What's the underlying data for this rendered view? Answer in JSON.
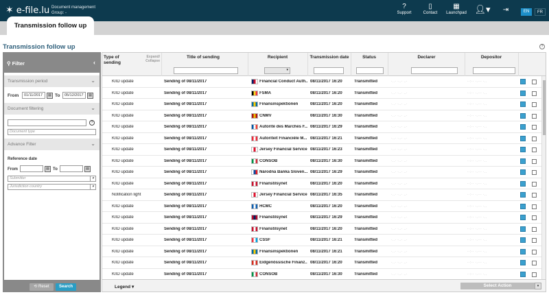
{
  "brand": {
    "name": "e-file.lu",
    "subtitle_line1": "Document management",
    "subtitle_line2": "Group: -"
  },
  "topnav": [
    {
      "label": "Support",
      "icon": "question-circle-icon"
    },
    {
      "label": "Contact",
      "icon": "phone-icon"
    },
    {
      "label": "Launchpad",
      "icon": "grid-icon"
    }
  ],
  "languages": {
    "en": "EN",
    "fr": "FR"
  },
  "tab": {
    "label": "Transmission follow up"
  },
  "page": {
    "title": "Transmission follow up",
    "help": "?"
  },
  "filter": {
    "title": "Filter",
    "sections": {
      "period": "Transmission period",
      "doc": "Document filtering",
      "advance": "Advance Filter"
    },
    "from_label": "From",
    "to_label": "To",
    "from_value": "01/11/2017",
    "to_value": "05/12/2017",
    "doc_type_placeholder": "Document type",
    "reference_date_label": "Reference date",
    "ref_from_label": "From",
    "ref_to_label": "To",
    "submitter_placeholder": "Submitter",
    "jurisdiction_placeholder": "Jurisdiction country",
    "reset_label": "Reset",
    "search_label": "Search"
  },
  "table": {
    "headers": {
      "type": "Type of sending",
      "expand": "Expand/ Collapse",
      "title": "Title of sending",
      "recipient": "Recipient",
      "date": "Transmission date",
      "status": "Status",
      "declarer": "Declarer",
      "depositor": "Depositor"
    },
    "rows": [
      {
        "type": "KIID update",
        "title": "Sending of 08/11/2017",
        "flag": "gb",
        "recipient": "Financial Conduct Auth...",
        "date": "08/11/2017 16:20",
        "status": "Transmitted",
        "declarer": "·..· ·..· ..·",
        "depositor": "··:·· ·.··· ·.."
      },
      {
        "type": "KIID update",
        "title": "Sending of 08/11/2017",
        "flag": "be",
        "recipient": "FSMA",
        "date": "08/11/2017 16:20",
        "status": "Transmitted",
        "declarer": "·..· ·..· ..·",
        "depositor": "··:·· ·.··· ·.."
      },
      {
        "type": "KIID update",
        "title": "Sending of 08/11/2017",
        "flag": "se",
        "recipient": "Finansinspektionen",
        "date": "08/11/2017 16:20",
        "status": "Transmitted",
        "declarer": "·..· ·..· ..·",
        "depositor": "··:·· ·.··· ·.."
      },
      {
        "type": "KIID update",
        "title": "Sending of 08/11/2017",
        "flag": "es",
        "recipient": "CNMV",
        "date": "08/11/2017 16:30",
        "status": "Transmitted",
        "declarer": "·..· ·..· ..·",
        "depositor": "··:·· ·.··· ·.."
      },
      {
        "type": "KIID update",
        "title": "Sending of 08/11/2017",
        "flag": "fr",
        "recipient": "Autorité des Marchés F...",
        "date": "08/11/2017 16:29",
        "status": "Transmitted",
        "declarer": "·..· ·..· ..·",
        "depositor": "··:·· ·.··· ·.."
      },
      {
        "type": "KIID update",
        "title": "Sending of 08/11/2017",
        "flag": "at",
        "recipient": "Autoriteit Financiële M...",
        "date": "08/11/2017 16:21",
        "status": "Transmitted",
        "declarer": "·..· ·..· ..·",
        "depositor": "··:·· ·.··· ·.."
      },
      {
        "type": "KIID update",
        "title": "Sending of 08/11/2017",
        "flag": "je",
        "recipient": "Jersey Financial Service...",
        "date": "08/11/2017 16:23",
        "status": "Transmitted",
        "declarer": "·..· ·..· ..·",
        "depositor": "··:·· ·.··· ·.."
      },
      {
        "type": "KIID update",
        "title": "Sending of 08/11/2017",
        "flag": "it",
        "recipient": "CONSOB",
        "date": "08/11/2017 16:30",
        "status": "Transmitted",
        "declarer": "·..· ·..· ..·",
        "depositor": "··:·· ·.··· ·.."
      },
      {
        "type": "KIID update",
        "title": "Sending of 08/11/2017",
        "flag": "sk",
        "recipient": "Národná Banka Sloven...",
        "date": "08/11/2017 16:29",
        "status": "Transmitted",
        "declarer": "·..· ·..· ..·",
        "depositor": "··:·· ·.··· ·.."
      },
      {
        "type": "KIID update",
        "title": "Sending of 08/11/2017",
        "flag": "dk",
        "recipient": "Finanstilsynet",
        "date": "08/11/2017 16:20",
        "status": "Transmitted",
        "declarer": "·..· ·..· ..·",
        "depositor": "··:·· ·.··· ·.."
      },
      {
        "type": "Notification light",
        "title": "Sending of 08/11/2017",
        "flag": "je",
        "recipient": "Jersey Financial Service...",
        "date": "08/11/2017 16:35",
        "status": "Transmitted",
        "declarer": "·..· ·..· ..·",
        "depositor": "··:·· ·.··· ·.."
      },
      {
        "type": "KIID update",
        "title": "Sending of 08/11/2017",
        "flag": "gr",
        "recipient": "HCMC",
        "date": "08/11/2017 16:20",
        "status": "Transmitted",
        "declarer": "·..· ·..· ..·",
        "depositor": "··:·· ·.··· ·.."
      },
      {
        "type": "KIID update",
        "title": "Sending of 08/11/2017",
        "flag": "no",
        "recipient": "Finanstilsynet",
        "date": "08/11/2017 16:29",
        "status": "Transmitted",
        "declarer": "·..· ·..· ..·",
        "depositor": "··:·· ·.··· ·.."
      },
      {
        "type": "KIID update",
        "title": "Sending of 08/11/2017",
        "flag": "dk",
        "recipient": "Finanstilsynet",
        "date": "08/11/2017 16:20",
        "status": "Transmitted",
        "declarer": "·..· ·..· ..·",
        "depositor": "··:·· ·.··· ·.."
      },
      {
        "type": "KIID update",
        "title": "Sending of 08/11/2017",
        "flag": "lu",
        "recipient": "CSSF",
        "date": "08/11/2017 16:21",
        "status": "Transmitted",
        "declarer": "·..· ·..· ..·",
        "depositor": "··:·· ·.··· ·.."
      },
      {
        "type": "KIID update",
        "title": "Sending of 08/11/2017",
        "flag": "se",
        "recipient": "Finansinspektionen",
        "date": "08/11/2017 16:21",
        "status": "Transmitted",
        "declarer": "·..· ·..· ..·",
        "depositor": "··:·· ·.··· ·.."
      },
      {
        "type": "KIID update",
        "title": "Sending of 08/11/2017",
        "flag": "ch",
        "recipient": "Eidgenössische Finanz...",
        "date": "08/11/2017 16:20",
        "status": "Transmitted",
        "declarer": "·..· ·..· ..·",
        "depositor": "··:·· ·.··· ·.."
      },
      {
        "type": "KIID update",
        "title": "Sending of 08/11/2017",
        "flag": "it",
        "recipient": "CONSOB",
        "date": "08/11/2017 16:30",
        "status": "Transmitted",
        "declarer": "·..· ·..· ..·",
        "depositor": "··:·· ·.··· ·.."
      }
    ],
    "legend_label": "Legend",
    "select_action_label": "Select Action"
  },
  "flag_colors": {
    "gb": [
      "#012169",
      "#c8102e",
      "#ffffff"
    ],
    "be": [
      "#000000",
      "#fdda24",
      "#ef3340"
    ],
    "se": [
      "#006aa7",
      "#fecc00",
      "#006aa7"
    ],
    "es": [
      "#aa151b",
      "#f1bf00",
      "#aa151b"
    ],
    "fr": [
      "#0055a4",
      "#ffffff",
      "#ef4135"
    ],
    "at": [
      "#ed2939",
      "#ffffff",
      "#ed2939"
    ],
    "je": [
      "#ffffff",
      "#df112d",
      "#ffffff"
    ],
    "it": [
      "#009246",
      "#ffffff",
      "#ce2b37"
    ],
    "sk": [
      "#ffffff",
      "#0b4ea2",
      "#ee1c25"
    ],
    "dk": [
      "#c8102e",
      "#ffffff",
      "#c8102e"
    ],
    "gr": [
      "#0d5eaf",
      "#ffffff",
      "#0d5eaf"
    ],
    "no": [
      "#ba0c2f",
      "#00205b",
      "#ba0c2f"
    ],
    "lu": [
      "#ef3340",
      "#ffffff",
      "#00a3e0"
    ],
    "ch": [
      "#d52b1e",
      "#ffffff",
      "#d52b1e"
    ]
  }
}
